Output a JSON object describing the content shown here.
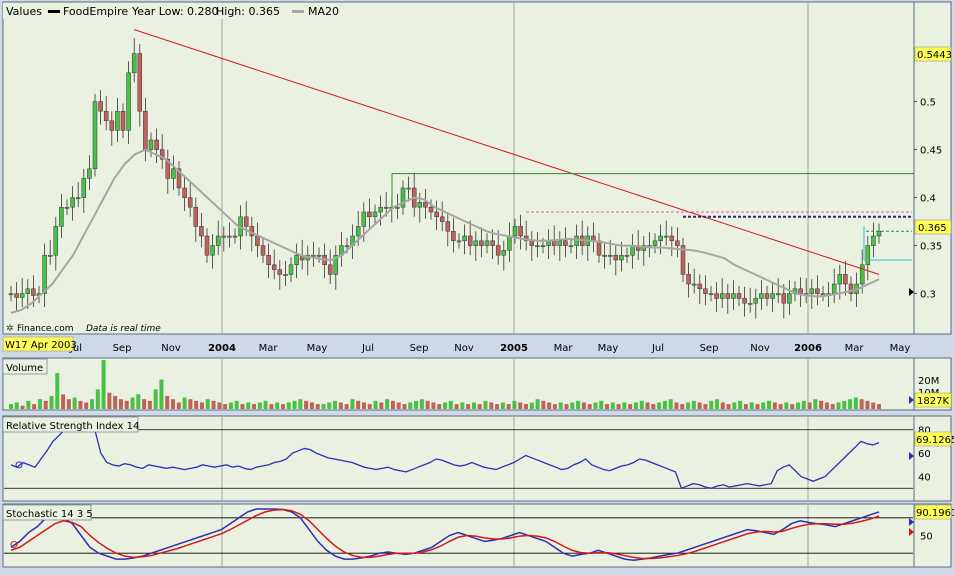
{
  "legend": {
    "values_label": "Values",
    "symbol_label": "FoodEmpire",
    "yearlow_label": "Year Low: 0.280",
    "yearhigh_label": "High: 0.365",
    "ma_label": "MA20"
  },
  "watermark": "Finance.com",
  "note": "Data is real time",
  "date_flag": "W17 Apr 2003",
  "colors": {
    "panel_bg": "#eaf1e0",
    "up_candle": "#47c247",
    "down_candle": "#c0625c",
    "trendline": "#d31a1a",
    "ma_line": "#a6a6a6",
    "rsi_line": "#2a2fb7",
    "stoch_k": "#2a2fb7",
    "stoch_d": "#d31a1a",
    "resistance": "#2f8a2f",
    "dotted_pink": "#e060b0",
    "dotted_navy": "#3a2080",
    "support": "#30c0c8",
    "flag_yellow": "#ffff55"
  },
  "chart_data": [
    {
      "type": "candlestick",
      "title": "FoodEmpire",
      "x_labels": [
        "Jul",
        "Sep",
        "Nov",
        "2004",
        "Mar",
        "May",
        "Jul",
        "Sep",
        "Nov",
        "2005",
        "Mar",
        "May",
        "Jul",
        "Sep",
        "Nov",
        "2006",
        "Mar",
        "May"
      ],
      "y_ticks": [
        0.3,
        0.35,
        0.4,
        0.45,
        0.5
      ],
      "ylim": [
        0.26,
        0.585
      ],
      "last_value_label": "0.365",
      "high_label": "0.5443",
      "close": [
        0.3,
        0.296,
        0.3,
        0.305,
        0.298,
        0.3,
        0.34,
        0.34,
        0.37,
        0.39,
        0.39,
        0.4,
        0.4,
        0.42,
        0.43,
        0.5,
        0.49,
        0.48,
        0.47,
        0.49,
        0.47,
        0.53,
        0.55,
        0.49,
        0.45,
        0.46,
        0.45,
        0.44,
        0.42,
        0.43,
        0.41,
        0.4,
        0.39,
        0.37,
        0.36,
        0.34,
        0.35,
        0.36,
        0.36,
        0.36,
        0.36,
        0.38,
        0.37,
        0.36,
        0.35,
        0.34,
        0.33,
        0.325,
        0.32,
        0.32,
        0.33,
        0.34,
        0.335,
        0.34,
        0.34,
        0.34,
        0.33,
        0.32,
        0.34,
        0.35,
        0.35,
        0.36,
        0.37,
        0.385,
        0.38,
        0.385,
        0.39,
        0.39,
        0.39,
        0.39,
        0.41,
        0.41,
        0.39,
        0.395,
        0.39,
        0.385,
        0.38,
        0.375,
        0.365,
        0.355,
        0.355,
        0.36,
        0.35,
        0.355,
        0.35,
        0.355,
        0.35,
        0.34,
        0.345,
        0.36,
        0.37,
        0.36,
        0.355,
        0.35,
        0.35,
        0.35,
        0.355,
        0.35,
        0.355,
        0.35,
        0.35,
        0.36,
        0.35,
        0.36,
        0.355,
        0.34,
        0.34,
        0.34,
        0.335,
        0.34,
        0.34,
        0.35,
        0.345,
        0.35,
        0.35,
        0.355,
        0.36,
        0.36,
        0.355,
        0.35,
        0.32,
        0.31,
        0.31,
        0.305,
        0.3,
        0.3,
        0.295,
        0.3,
        0.295,
        0.3,
        0.295,
        0.29,
        0.29,
        0.295,
        0.3,
        0.295,
        0.3,
        0.3,
        0.29,
        0.3,
        0.305,
        0.3,
        0.3,
        0.305,
        0.3,
        0.3,
        0.3,
        0.31,
        0.32,
        0.31,
        0.3,
        0.31,
        0.33,
        0.35,
        0.36,
        0.365
      ],
      "series": [
        {
          "name": "FoodEmpire"
        },
        {
          "name": "MA20",
          "values": [
            0.28,
            0.283,
            0.29,
            0.3,
            0.31,
            0.325,
            0.34,
            0.36,
            0.38,
            0.4,
            0.42,
            0.435,
            0.445,
            0.45,
            0.445,
            0.44,
            0.43,
            0.42,
            0.41,
            0.4,
            0.39,
            0.38,
            0.37,
            0.365,
            0.36,
            0.355,
            0.35,
            0.345,
            0.34,
            0.338,
            0.336,
            0.335,
            0.34,
            0.35,
            0.36,
            0.37,
            0.38,
            0.39,
            0.395,
            0.4,
            0.398,
            0.39,
            0.385,
            0.38,
            0.375,
            0.37,
            0.365,
            0.362,
            0.36,
            0.358,
            0.356,
            0.355,
            0.355,
            0.356,
            0.357,
            0.356,
            0.355,
            0.354,
            0.352,
            0.35,
            0.35,
            0.349,
            0.348,
            0.348,
            0.347,
            0.346,
            0.345,
            0.343,
            0.34,
            0.337,
            0.33,
            0.325,
            0.32,
            0.315,
            0.31,
            0.305,
            0.3,
            0.298,
            0.297,
            0.298,
            0.3,
            0.302,
            0.305,
            0.31,
            0.315
          ]
        }
      ],
      "trendline": {
        "from": [
          0.575
        ],
        "to": [
          0.32
        ]
      },
      "resistance_level": 0.425,
      "dotted_levels": [
        0.385,
        0.38
      ],
      "support_level": 0.335
    },
    {
      "type": "bar",
      "title": "Volume",
      "y_ticks_labels": [
        "20M",
        "10M"
      ],
      "last_value_label": "1827K",
      "values": [
        3,
        4,
        2,
        5,
        3,
        6,
        5,
        8,
        22,
        9,
        6,
        7,
        5,
        4,
        6,
        12,
        30,
        10,
        8,
        6,
        5,
        7,
        9,
        6,
        5,
        12,
        18,
        8,
        6,
        4,
        7,
        6,
        5,
        4,
        6,
        5,
        4,
        3,
        4,
        5,
        3,
        4,
        3,
        4,
        5,
        3,
        4,
        3,
        4,
        5,
        6,
        5,
        4,
        3,
        3,
        4,
        5,
        4,
        3,
        6,
        5,
        4,
        3,
        5,
        4,
        6,
        5,
        4,
        3,
        4,
        5,
        6,
        5,
        4,
        3,
        4,
        5,
        3,
        4,
        3,
        4,
        3,
        5,
        4,
        3,
        4,
        3,
        5,
        4,
        3,
        4,
        6,
        5,
        4,
        3,
        4,
        3,
        4,
        5,
        4,
        3,
        4,
        5,
        3,
        4,
        3,
        4,
        3,
        4,
        5,
        4,
        3,
        4,
        5,
        6,
        4,
        3,
        4,
        5,
        4,
        3,
        5,
        6,
        4,
        3,
        4,
        5,
        3,
        4,
        3,
        4,
        5,
        4,
        3,
        4,
        3,
        4,
        5,
        4,
        6,
        5,
        4,
        3,
        4,
        5,
        6,
        7,
        6,
        5,
        4,
        3
      ]
    },
    {
      "type": "line",
      "title": "Relative Strength Index 14",
      "y_ticks": [
        80,
        60,
        40
      ],
      "last_value_label": "69.1265",
      "values": [
        50,
        48,
        52,
        50,
        48,
        55,
        62,
        70,
        75,
        80,
        82,
        85,
        86,
        84,
        80,
        60,
        52,
        50,
        49,
        51,
        50,
        48,
        47,
        50,
        49,
        48,
        47,
        48,
        47,
        46,
        47,
        48,
        50,
        49,
        48,
        49,
        50,
        48,
        49,
        47,
        46,
        48,
        49,
        50,
        52,
        53,
        55,
        60,
        62,
        64,
        63,
        60,
        58,
        56,
        55,
        54,
        53,
        52,
        50,
        48,
        47,
        46,
        47,
        48,
        46,
        45,
        44,
        46,
        48,
        50,
        52,
        55,
        54,
        52,
        50,
        49,
        50,
        52,
        50,
        48,
        47,
        46,
        48,
        50,
        52,
        55,
        58,
        56,
        54,
        52,
        50,
        48,
        46,
        47,
        50,
        52,
        55,
        50,
        48,
        46,
        45,
        47,
        49,
        50,
        52,
        55,
        54,
        52,
        50,
        48,
        46,
        44,
        30,
        32,
        34,
        33,
        31,
        30,
        32,
        33,
        31,
        32,
        33,
        34,
        33,
        32,
        33,
        34,
        45,
        48,
        50,
        45,
        40,
        38,
        36,
        38,
        40,
        45,
        50,
        55,
        60,
        65,
        70,
        68,
        67,
        69
      ]
    },
    {
      "type": "line",
      "title": "Stochastic 14 3 5",
      "y_ticks": [
        50
      ],
      "last_value_label": "90.1961",
      "series": [
        {
          "name": "%K",
          "values": [
            30,
            40,
            55,
            65,
            80,
            85,
            80,
            70,
            50,
            30,
            20,
            15,
            10,
            10,
            12,
            15,
            20,
            25,
            30,
            35,
            40,
            45,
            50,
            55,
            60,
            70,
            80,
            90,
            95,
            95,
            95,
            94,
            90,
            80,
            60,
            40,
            25,
            15,
            10,
            10,
            12,
            15,
            20,
            22,
            20,
            18,
            20,
            25,
            30,
            40,
            50,
            55,
            50,
            45,
            40,
            42,
            45,
            50,
            55,
            50,
            45,
            40,
            30,
            20,
            15,
            18,
            20,
            25,
            20,
            15,
            10,
            8,
            10,
            12,
            15,
            18,
            20,
            25,
            30,
            35,
            40,
            45,
            50,
            55,
            60,
            58,
            55,
            52,
            60,
            70,
            75,
            72,
            70,
            68,
            65,
            70,
            75,
            80,
            85,
            90
          ]
        },
        {
          "name": "%D",
          "values": [
            25,
            30,
            40,
            50,
            60,
            70,
            75,
            72,
            65,
            50,
            38,
            28,
            20,
            15,
            13,
            14,
            16,
            20,
            24,
            28,
            33,
            38,
            43,
            48,
            53,
            60,
            68,
            76,
            84,
            90,
            93,
            94,
            92,
            86,
            75,
            60,
            45,
            32,
            22,
            16,
            13,
            13,
            15,
            18,
            20,
            20,
            20,
            22,
            26,
            32,
            40,
            47,
            50,
            49,
            46,
            44,
            44,
            46,
            49,
            50,
            49,
            46,
            40,
            32,
            25,
            21,
            20,
            21,
            21,
            19,
            16,
            13,
            11,
            11,
            12,
            14,
            16,
            19,
            23,
            28,
            33,
            38,
            43,
            48,
            53,
            56,
            57,
            56,
            57,
            62,
            66,
            69,
            70,
            70,
            69,
            69,
            71,
            74,
            78,
            83
          ]
        }
      ]
    }
  ]
}
